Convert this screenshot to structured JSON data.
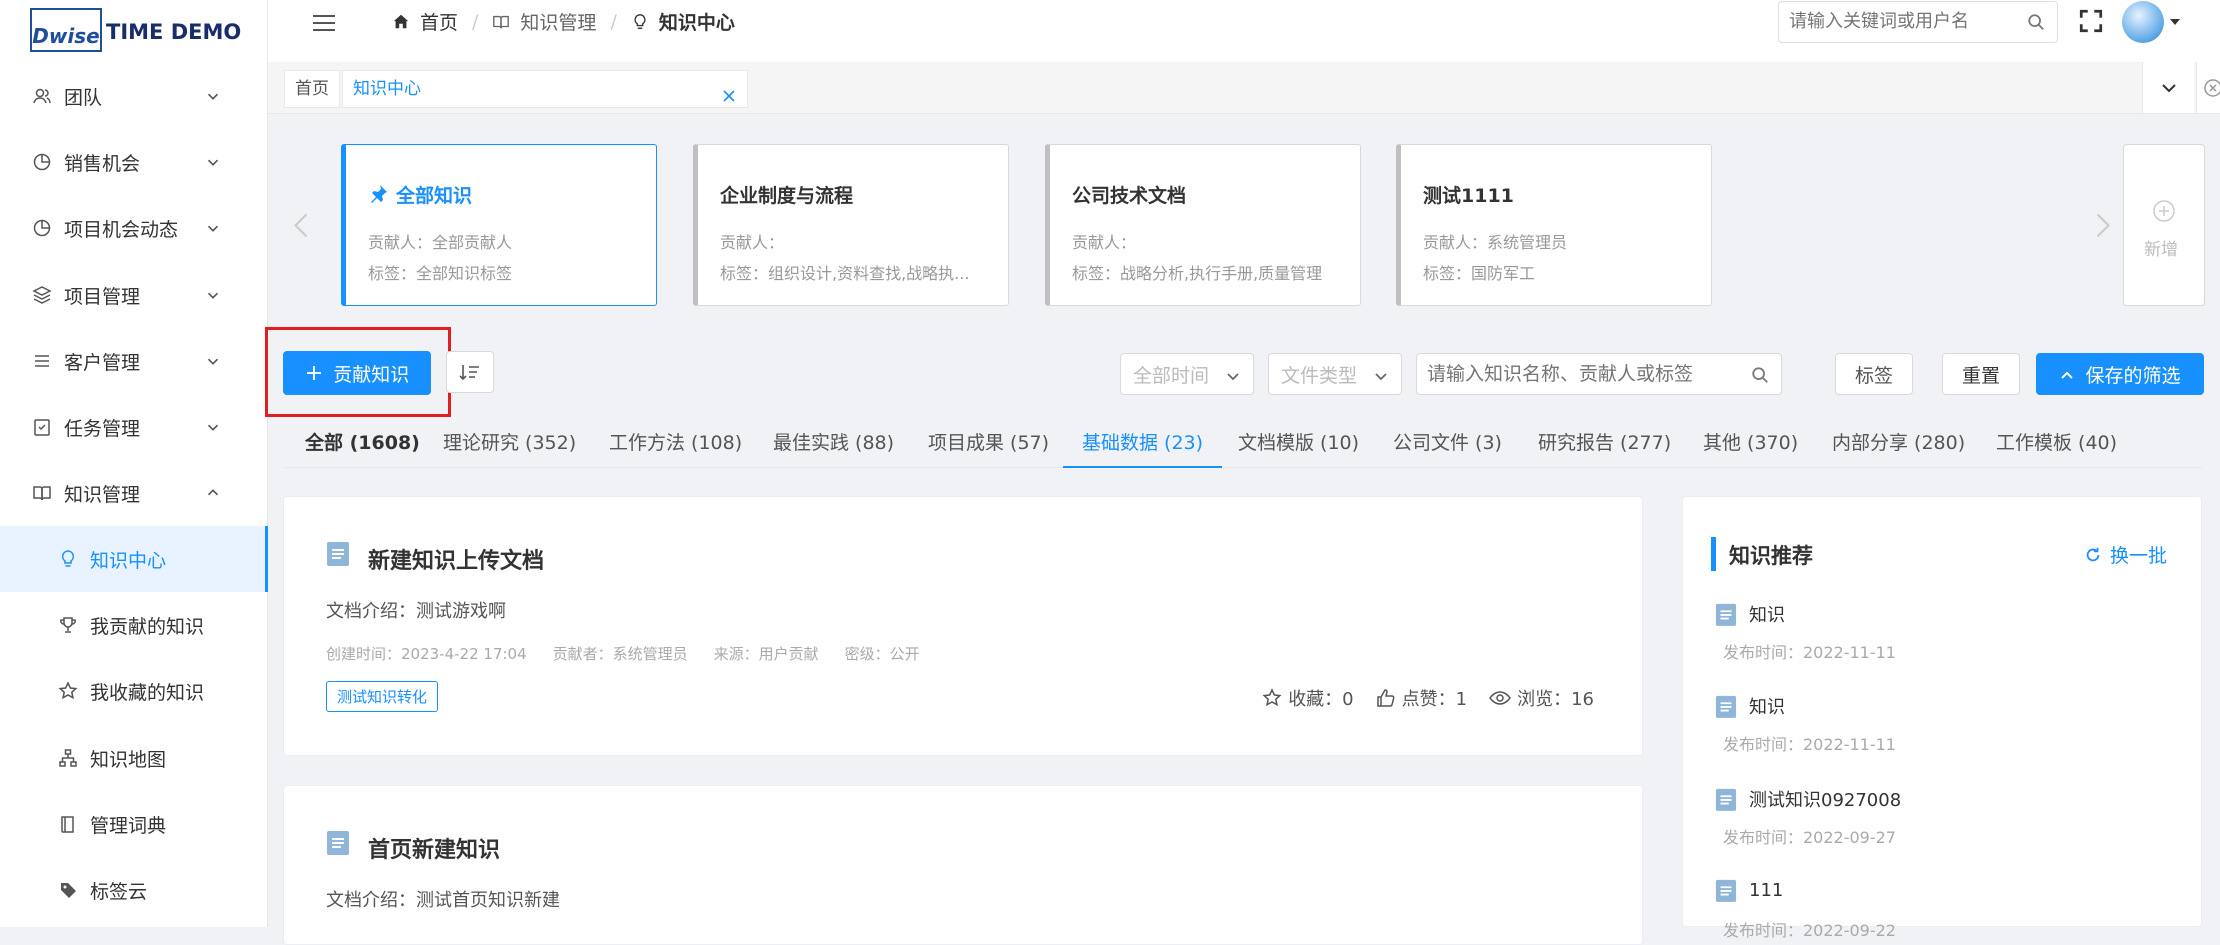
{
  "brand": {
    "logo_mark": "Dwise",
    "name": "TIME DEMO"
  },
  "sidebar": {
    "items": [
      {
        "label": "团队",
        "icon": "team-icon"
      },
      {
        "label": "销售机会",
        "icon": "pie-chart-icon"
      },
      {
        "label": "项目机会动态",
        "icon": "pie-chart-icon"
      },
      {
        "label": "项目管理",
        "icon": "layers-icon"
      },
      {
        "label": "客户管理",
        "icon": "list-icon"
      },
      {
        "label": "任务管理",
        "icon": "task-icon"
      },
      {
        "label": "知识管理",
        "icon": "book-icon"
      }
    ],
    "subitems": [
      {
        "label": "知识中心",
        "icon": "bulb-icon"
      },
      {
        "label": "我贡献的知识",
        "icon": "trophy-icon"
      },
      {
        "label": "我收藏的知识",
        "icon": "star-icon"
      },
      {
        "label": "知识地图",
        "icon": "sitemap-icon"
      },
      {
        "label": "管理词典",
        "icon": "dictionary-icon"
      },
      {
        "label": "标签云",
        "icon": "tag-icon"
      }
    ]
  },
  "header": {
    "breadcrumb": [
      "首页",
      "知识管理",
      "知识中心"
    ],
    "search_placeholder": "请输入关键词或用户名"
  },
  "tabs": {
    "home": "首页",
    "current": "知识中心"
  },
  "cards": [
    {
      "title": "全部知识",
      "contributor": "贡献人：全部贡献人",
      "tags": "标签：全部知识标签"
    },
    {
      "title": "企业制度与流程",
      "contributor": "贡献人：",
      "tags": "标签：组织设计,资料查找,战略执..."
    },
    {
      "title": "公司技术文档",
      "contributor": "贡献人：",
      "tags": "标签：战略分析,执行手册,质量管理"
    },
    {
      "title": "测试1111",
      "contributor": "贡献人：系统管理员",
      "tags": "标签：国防军工"
    }
  ],
  "add_card_label": "新增",
  "toolbar": {
    "contribute": "贡献知识",
    "time_filter": "全部时间",
    "file_type": "文件类型",
    "search_placeholder": "请输入知识名称、贡献人或标签",
    "tag_btn": "标签",
    "reset_btn": "重置",
    "save_filter_btn": "保存的筛选"
  },
  "category_tabs": [
    "全部 (1608)",
    "理论研究 (352)",
    "工作方法 (108)",
    "最佳实践 (88)",
    "项目成果 (57)",
    "基础数据 (23)",
    "文档模版 (10)",
    "公司文件 (3)",
    "研究报告 (277)",
    "其他 (370)",
    "内部分享 (280)",
    "工作模板 (40)"
  ],
  "docs": [
    {
      "title": "新建知识上传文档",
      "intro": "文档介绍：测试游戏啊",
      "created": "创建时间：2023-4-22 17:04",
      "contributor": "贡献者：系统管理员",
      "source": "来源：用户贡献",
      "secret": "密级：公开",
      "tag": "测试知识转化",
      "favorites": "收藏：0",
      "likes": "点赞：1",
      "views": "浏览：16"
    },
    {
      "title": "首页新建知识",
      "intro": "文档介绍：测试首页知识新建"
    }
  ],
  "recommend": {
    "title": "知识推荐",
    "refresh": "换一批",
    "items": [
      {
        "title": "知识",
        "date": "发布时间：2022-11-11"
      },
      {
        "title": "知识",
        "date": "发布时间：2022-11-11"
      },
      {
        "title": "测试知识0927008",
        "date": "发布时间：2022-09-27"
      },
      {
        "title": "111",
        "date": "发布时间：2022-09-22"
      }
    ]
  },
  "colors": {
    "accent": "#1890ff",
    "highlight_box": "#e02020"
  }
}
